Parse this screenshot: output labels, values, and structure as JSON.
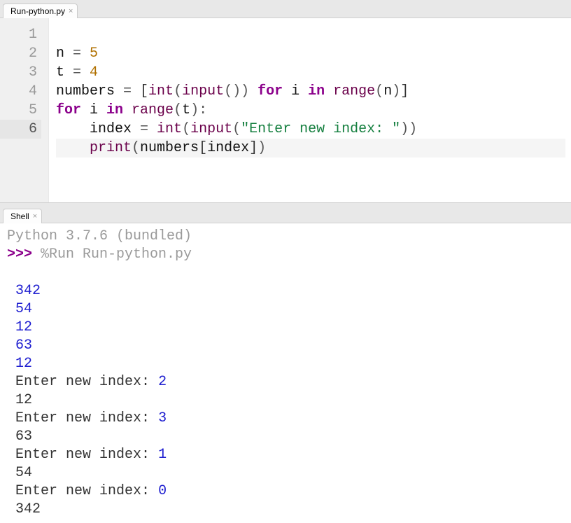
{
  "editor": {
    "tab_label": "Run-python.py",
    "current_line": 6,
    "lines": {
      "l1_n": "n",
      "l1_eq": " = ",
      "l1_val": "5",
      "l2_t": "t",
      "l2_eq": " = ",
      "l2_val": "4",
      "l3_numbers": "numbers",
      "l3_eq": " = ",
      "l3_lb": "[",
      "l3_int": "int",
      "l3_p1": "(",
      "l3_input": "input",
      "l3_p2": "())",
      "l3_for": " for ",
      "l3_i": "i",
      "l3_in": " in ",
      "l3_range": "range",
      "l3_p3": "(",
      "l3_n": "n",
      "l3_p4": ")",
      "l3_rb": "]",
      "l4_for": "for ",
      "l4_i": "i",
      "l4_in": " in ",
      "l4_range": "range",
      "l4_p1": "(",
      "l4_t": "t",
      "l4_p2": "):",
      "l5_indent": "    ",
      "l5_index": "index",
      "l5_eq": " = ",
      "l5_int": "int",
      "l5_p1": "(",
      "l5_input": "input",
      "l5_p2": "(",
      "l5_str": "\"Enter new index: \"",
      "l5_p3": "))",
      "l6_indent": "    ",
      "l6_print": "print",
      "l6_p1": "(",
      "l6_numbers": "numbers",
      "l6_lb": "[",
      "l6_index": "index",
      "l6_rb": "]",
      "l6_p2": ")"
    },
    "line_numbers": [
      "1",
      "2",
      "3",
      "4",
      "5",
      "6"
    ]
  },
  "shell": {
    "tab_label": "Shell",
    "banner": "Python 3.7.6 (bundled)",
    "prompt": ">>> ",
    "run_cmd": "%Run Run-python.py",
    "io": [
      {
        "type": "input",
        "text": "342"
      },
      {
        "type": "input",
        "text": "54"
      },
      {
        "type": "input",
        "text": "12"
      },
      {
        "type": "input",
        "text": "63"
      },
      {
        "type": "input",
        "text": "12"
      },
      {
        "type": "prompted",
        "prompt": "Enter new index: ",
        "value": "2"
      },
      {
        "type": "output",
        "text": "12"
      },
      {
        "type": "prompted",
        "prompt": "Enter new index: ",
        "value": "3"
      },
      {
        "type": "output",
        "text": "63"
      },
      {
        "type": "prompted",
        "prompt": "Enter new index: ",
        "value": "1"
      },
      {
        "type": "output",
        "text": "54"
      },
      {
        "type": "prompted",
        "prompt": "Enter new index: ",
        "value": "0"
      },
      {
        "type": "output",
        "text": "342"
      }
    ]
  }
}
